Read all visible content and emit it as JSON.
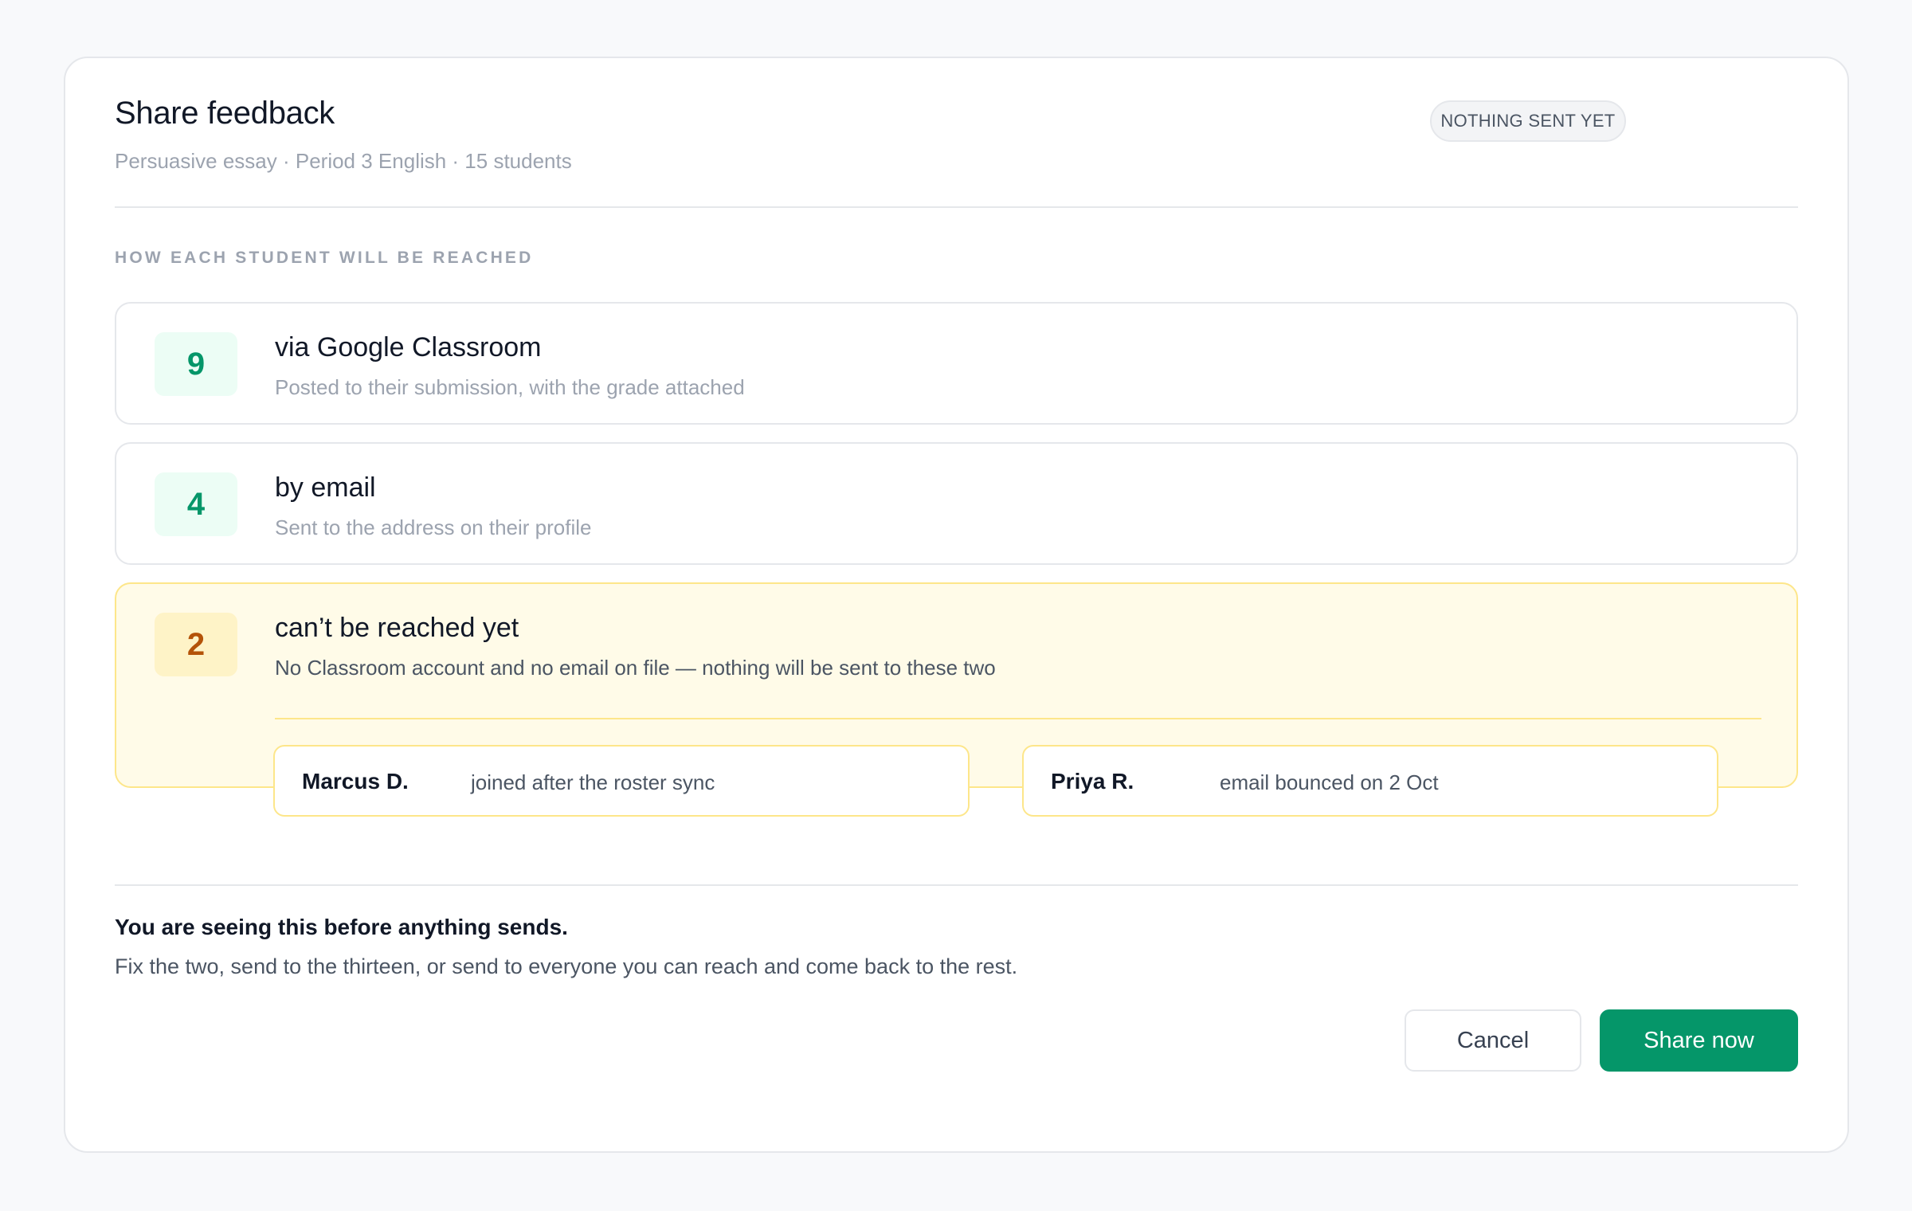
{
  "header": {
    "title": "Share feedback",
    "subtitle": "Persuasive essay · Period 3 English · 15 students",
    "status_badge": "NOTHING SENT YET"
  },
  "section_label": "HOW EACH STUDENT WILL BE REACHED",
  "channels": [
    {
      "count": "9",
      "title": "via Google Classroom",
      "description": "Posted to their submission, with the grade attached"
    },
    {
      "count": "4",
      "title": "by email",
      "description": "Sent to the address on their profile"
    },
    {
      "count": "2",
      "title": "can’t be reached yet",
      "description": "No Classroom account and no email on file — nothing will be sent to these two"
    }
  ],
  "unreachable_students": [
    {
      "name": "Marcus D.",
      "reason": "joined after the roster sync"
    },
    {
      "name": "Priya R.",
      "reason": "email bounced on 2 Oct"
    }
  ],
  "footer": {
    "note_title": "You are seeing this before anything sends.",
    "note_body": "Fix the two, send to the thirteen, or send to everyone you can reach and come back to the rest.",
    "cancel_label": "Cancel",
    "share_label": "Share now"
  },
  "colors": {
    "accent": "#059669",
    "warning_bg": "#fffbe8",
    "warning_border": "#fde68a",
    "warning_text": "#b45309"
  }
}
